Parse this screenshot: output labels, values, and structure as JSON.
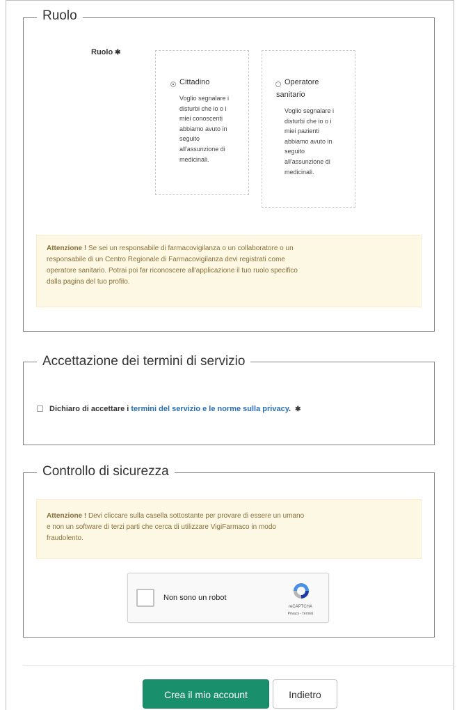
{
  "role_section": {
    "legend": "Ruolo",
    "field_label": "Ruolo",
    "required_mark": "✱",
    "options": [
      {
        "title": "Cittadino",
        "checked": true,
        "description": [
          "Voglio segnalare i",
          "disturbi che io o i",
          "miei conoscenti",
          "abbiamo avuto in",
          "seguito",
          "all'assunzione di",
          "medicinali."
        ]
      },
      {
        "title_line1": "Operatore",
        "title_line2": "sanitario",
        "checked": false,
        "description": [
          "Voglio segnalare i",
          "disturbi che io o i",
          "miei pazienti",
          "abbiamo avuto in",
          "seguito",
          "all'assunzione di",
          "medicinali."
        ]
      }
    ],
    "alert": {
      "prefix": "Attenzione !",
      "lines": [
        "Se sei un responsabile di farmacovigilanza o un collaboratore o un",
        "responsabile di un Centro Regionale di Farmacovigilanza devi registrati come",
        "operatore sanitario. Potrai poi far riconoscere all'applicazione il tuo ruolo specifico",
        "dalla pagina del tuo profilo."
      ]
    }
  },
  "terms_section": {
    "legend": "Accettazione dei termini di servizio",
    "label_prefix": "Dichiaro di accettare i",
    "link_text": "termini del servizio e le norme sulla privacy",
    "label_suffix": ".",
    "required_mark": "✱"
  },
  "security_section": {
    "legend": "Controllo di sicurezza",
    "alert": {
      "prefix": "Attenzione !",
      "lines": [
        "Devi cliccare sulla casella sottostante per provare di essere un umano",
        "e non un software di terzi parti che cerca di utilizzare VigiFarmaco in modo",
        "fraudolento."
      ]
    },
    "captcha": {
      "label": "Non sono un robot",
      "brand": "reCAPTCHA",
      "links": "Privacy - Termini"
    }
  },
  "actions": {
    "submit_label": "Crea il mio account",
    "back_label": "Indietro"
  },
  "colors": {
    "primary_button": "#1a8f6b",
    "alert_bg": "#fcf8e3",
    "alert_text": "#8a6d3b",
    "link": "#2a6fb0"
  }
}
